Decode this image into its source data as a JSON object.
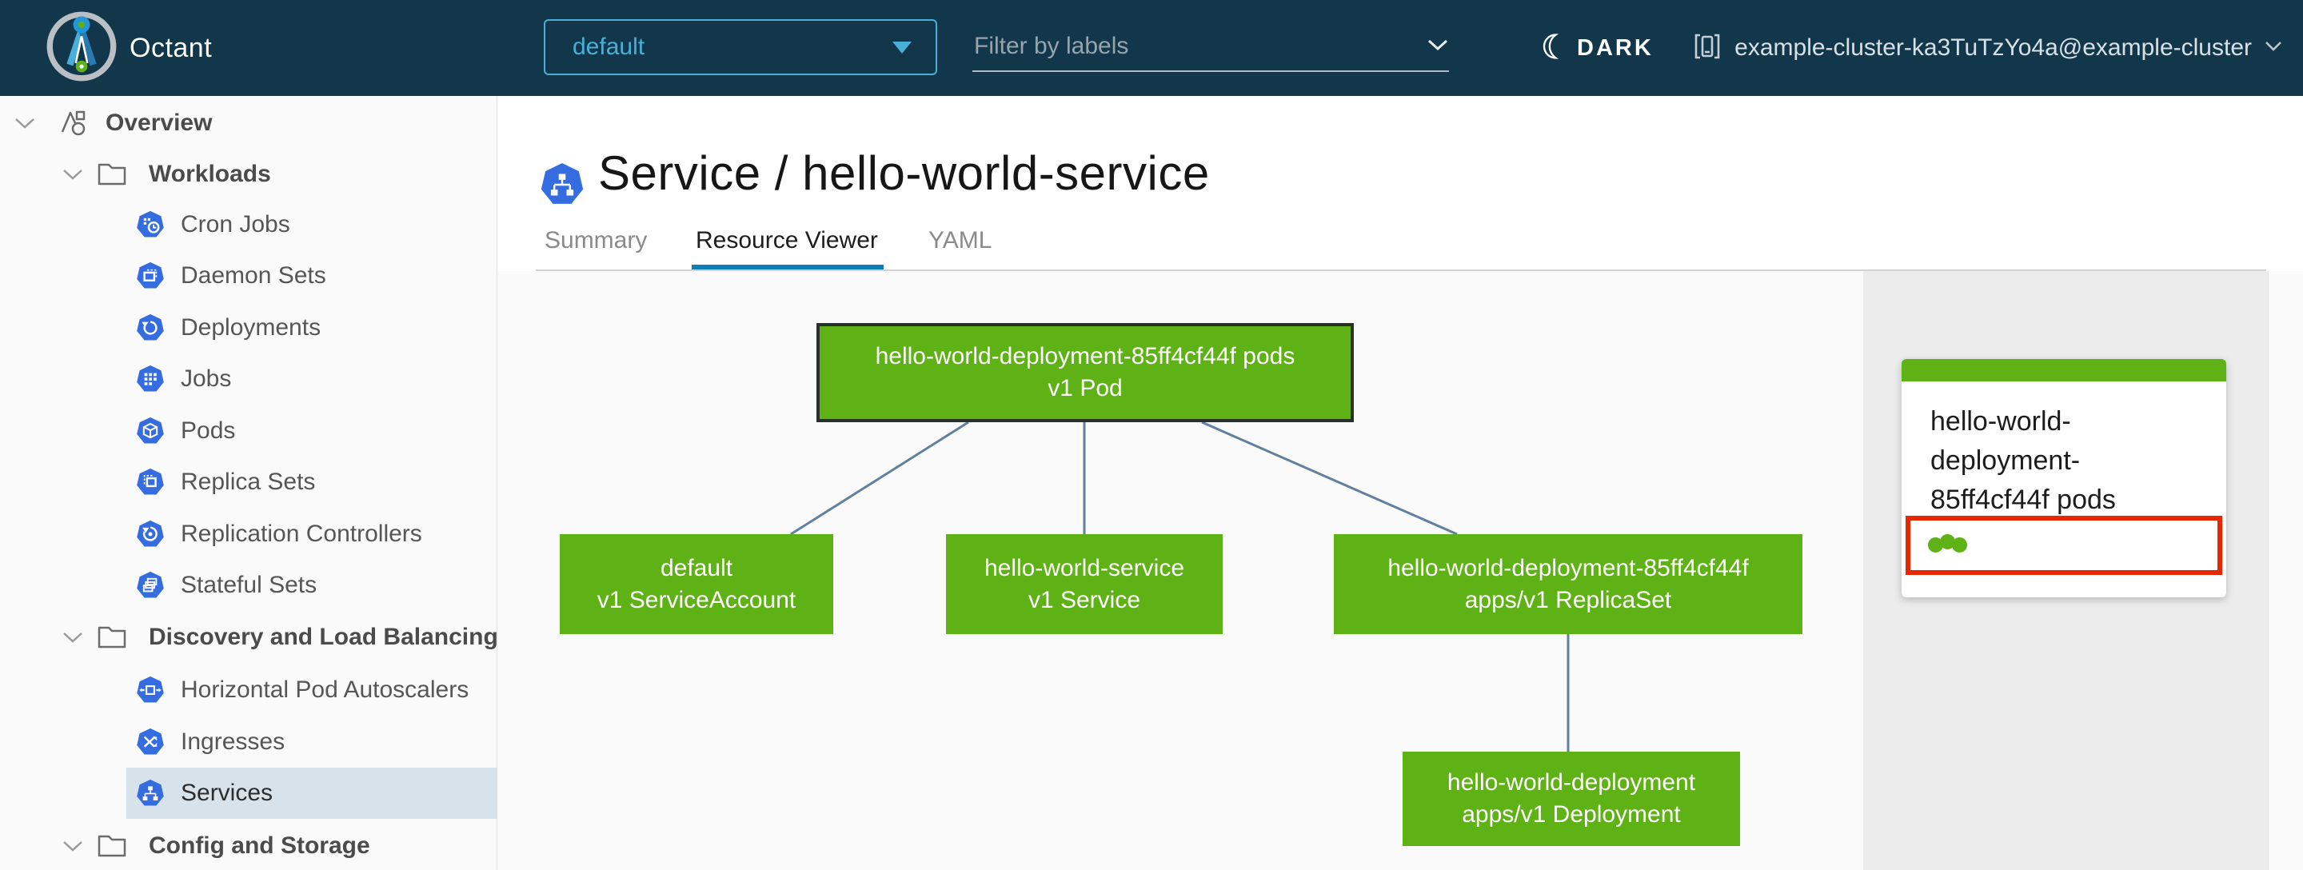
{
  "header": {
    "app_title": "Octant",
    "namespace_selector": {
      "value": "default"
    },
    "filter_input": {
      "placeholder": "Filter by labels"
    },
    "theme_toggle": {
      "label": "DARK"
    },
    "cluster_selector": {
      "value": "example-cluster-ka3TuTzYo4a@example-cluster"
    },
    "colors": {
      "background": "#12374a",
      "accent_blue": "#49afd9"
    }
  },
  "sidebar": {
    "items": [
      {
        "label": "Overview",
        "level": 1,
        "type": "section",
        "icon": "applications-icon",
        "expanded": true,
        "selected": false
      },
      {
        "label": "Workloads",
        "level": 2,
        "type": "section",
        "icon": "folder-icon",
        "expanded": true,
        "selected": false
      },
      {
        "label": "Cron Jobs",
        "level": 3,
        "type": "item",
        "icon": "cronjob-icon",
        "selected": false
      },
      {
        "label": "Daemon Sets",
        "level": 3,
        "type": "item",
        "icon": "daemonset-icon",
        "selected": false
      },
      {
        "label": "Deployments",
        "level": 3,
        "type": "item",
        "icon": "deployment-icon",
        "selected": false
      },
      {
        "label": "Jobs",
        "level": 3,
        "type": "item",
        "icon": "job-icon",
        "selected": false
      },
      {
        "label": "Pods",
        "level": 3,
        "type": "item",
        "icon": "pod-icon",
        "selected": false
      },
      {
        "label": "Replica Sets",
        "level": 3,
        "type": "item",
        "icon": "replicaset-icon",
        "selected": false
      },
      {
        "label": "Replication Controllers",
        "level": 3,
        "type": "item",
        "icon": "replicationcontroller-icon",
        "selected": false
      },
      {
        "label": "Stateful Sets",
        "level": 3,
        "type": "item",
        "icon": "statefulset-icon",
        "selected": false
      },
      {
        "label": "Discovery and Load Balancing",
        "level": 2,
        "type": "section",
        "icon": "folder-icon",
        "expanded": true,
        "selected": false
      },
      {
        "label": "Horizontal Pod Autoscalers",
        "level": 3,
        "type": "item",
        "icon": "hpa-icon",
        "selected": false
      },
      {
        "label": "Ingresses",
        "level": 3,
        "type": "item",
        "icon": "ingress-icon",
        "selected": false
      },
      {
        "label": "Services",
        "level": 3,
        "type": "item",
        "icon": "service-icon",
        "selected": true
      },
      {
        "label": "Config and Storage",
        "level": 2,
        "type": "section",
        "icon": "folder-icon",
        "expanded": true,
        "selected": false
      }
    ]
  },
  "main": {
    "page_title": "Service / hello-world-service",
    "page_title_icon": "service-icon",
    "tabs": [
      {
        "label": "Summary",
        "active": false
      },
      {
        "label": "Resource Viewer",
        "active": true
      },
      {
        "label": "YAML",
        "active": false
      }
    ]
  },
  "resource_viewer": {
    "nodes": [
      {
        "name": "hello-world-deployment-85ff4cf44f pods",
        "kind": "v1 Pod",
        "status": "ok",
        "selected": true
      },
      {
        "name": "default",
        "kind": "v1 ServiceAccount",
        "status": "ok",
        "selected": false
      },
      {
        "name": "hello-world-service",
        "kind": "v1 Service",
        "status": "ok",
        "selected": false
      },
      {
        "name": "hello-world-deployment-85ff4cf44f",
        "kind": "apps/v1 ReplicaSet",
        "status": "ok",
        "selected": false
      },
      {
        "name": "hello-world-deployment",
        "kind": "apps/v1 Deployment",
        "status": "ok",
        "selected": false
      }
    ],
    "edges": [
      {
        "from": "hello-world-deployment-85ff4cf44f pods",
        "to": "default"
      },
      {
        "from": "hello-world-deployment-85ff4cf44f pods",
        "to": "hello-world-service"
      },
      {
        "from": "hello-world-deployment-85ff4cf44f pods",
        "to": "hello-world-deployment-85ff4cf44f"
      },
      {
        "from": "hello-world-deployment-85ff4cf44f",
        "to": "hello-world-deployment"
      }
    ],
    "node_color": "#5fb215",
    "edge_color": "#61809f"
  },
  "detail_panel": {
    "card": {
      "title": "hello-world-deployment-85ff4cf44f pods",
      "header_color": "#5fb215",
      "pod_status": {
        "dot_count": 3,
        "dot_color": "#5fb215",
        "highlighted": true,
        "highlight_color": "#e62700"
      }
    }
  }
}
